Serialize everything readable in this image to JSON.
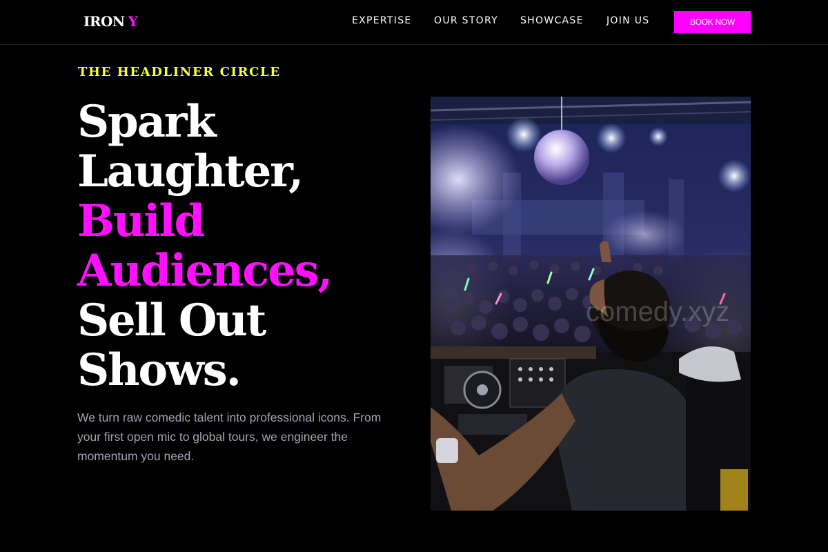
{
  "header": {
    "logo": {
      "main": "IRON",
      "accent": "Y"
    },
    "nav": [
      {
        "label": "EXPERTISE"
      },
      {
        "label": "OUR STORY"
      },
      {
        "label": "SHOWCASE"
      },
      {
        "label": "JOIN US"
      }
    ],
    "cta_label": "BOOK NOW"
  },
  "hero": {
    "eyebrow": "THE HEADLINER CIRCLE",
    "headline_lines": [
      "Spark",
      "Laughter,",
      "Build",
      "Audiences,",
      "Sell Out",
      "Shows."
    ],
    "description": "We turn raw comedic talent into professional icons. From your first open mic to global tours, we engineer the momentum you need.",
    "image": {
      "subject": "dj-performing-to-club-crowd-photo"
    }
  },
  "colors": {
    "background": "#000000",
    "accent_magenta": "#ff00ff",
    "eyebrow_yellow": "#f4ff3d",
    "body_text": "#a3a3b2"
  }
}
